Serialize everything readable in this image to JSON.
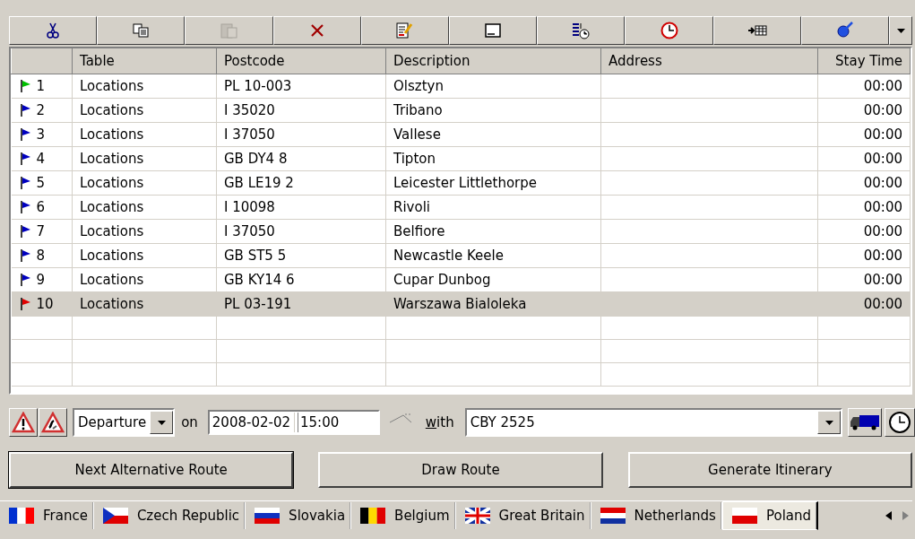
{
  "toolbar": [
    {
      "kind": "cut",
      "disabled": false
    },
    {
      "kind": "copy",
      "disabled": false
    },
    {
      "kind": "paste",
      "disabled": true
    },
    {
      "kind": "delete",
      "disabled": false
    },
    {
      "kind": "edit",
      "disabled": false
    },
    {
      "kind": "window",
      "disabled": false
    },
    {
      "kind": "schedule",
      "disabled": false
    },
    {
      "kind": "clock",
      "disabled": false
    },
    {
      "kind": "insert",
      "disabled": false
    },
    {
      "kind": "pin",
      "disabled": false
    }
  ],
  "table": {
    "columns": [
      "Table",
      "Postcode",
      "Description",
      "Address",
      "Stay Time"
    ],
    "rows": [
      {
        "number": "1",
        "color": "#00c000",
        "selected": false,
        "cells": [
          "Locations",
          "PL 10-003",
          "Olsztyn",
          "",
          "00:00"
        ]
      },
      {
        "number": "2",
        "color": "#0000c0",
        "selected": false,
        "cells": [
          "Locations",
          "I 35020",
          "Tribano",
          "",
          "00:00"
        ]
      },
      {
        "number": "3",
        "color": "#0000c0",
        "selected": false,
        "cells": [
          "Locations",
          "I 37050",
          "Vallese",
          "",
          "00:00"
        ]
      },
      {
        "number": "4",
        "color": "#0000c0",
        "selected": false,
        "cells": [
          "Locations",
          "GB DY4 8",
          "Tipton",
          "",
          "00:00"
        ]
      },
      {
        "number": "5",
        "color": "#0000c0",
        "selected": false,
        "cells": [
          "Locations",
          "GB LE19 2",
          "Leicester Littlethorpe",
          "",
          "00:00"
        ]
      },
      {
        "number": "6",
        "color": "#0000c0",
        "selected": false,
        "cells": [
          "Locations",
          "I 10098",
          "Rivoli",
          "",
          "00:00"
        ]
      },
      {
        "number": "7",
        "color": "#0000c0",
        "selected": false,
        "cells": [
          "Locations",
          "I 37050",
          "Belfiore",
          "",
          "00:00"
        ]
      },
      {
        "number": "8",
        "color": "#0000c0",
        "selected": false,
        "cells": [
          "Locations",
          "GB ST5 5",
          "Newcastle Keele",
          "",
          "00:00"
        ]
      },
      {
        "number": "9",
        "color": "#0000c0",
        "selected": false,
        "cells": [
          "Locations",
          "GB KY14 6",
          "Cupar Dunbog",
          "",
          "00:00"
        ]
      },
      {
        "number": "10",
        "color": "#e00000",
        "selected": true,
        "cells": [
          "Locations",
          "PL 03-191",
          "Warszawa Bialoleka",
          "",
          "00:00"
        ]
      }
    ]
  },
  "controls": {
    "mode": "Departure",
    "on_label": "on",
    "date": "2008-02-02",
    "time": "15:00",
    "with_label": "with",
    "vehicle": "CBY 2525"
  },
  "buttons": [
    {
      "label": "Next Alternative Route",
      "selected": true
    },
    {
      "label": "Draw Route",
      "selected": false
    },
    {
      "label": "Generate Itinerary",
      "selected": false
    }
  ],
  "tabs": [
    {
      "label": "France",
      "kind": "france",
      "selected": false
    },
    {
      "label": "Czech Republic",
      "kind": "czech",
      "selected": false
    },
    {
      "label": "Slovakia",
      "kind": "slovakia",
      "selected": false
    },
    {
      "label": "Belgium",
      "kind": "belgium",
      "selected": false
    },
    {
      "label": "Great Britain",
      "kind": "britain",
      "selected": false
    },
    {
      "label": "Netherlands",
      "kind": "netherlands",
      "selected": false
    },
    {
      "label": "Poland",
      "kind": "poland",
      "selected": true
    }
  ]
}
